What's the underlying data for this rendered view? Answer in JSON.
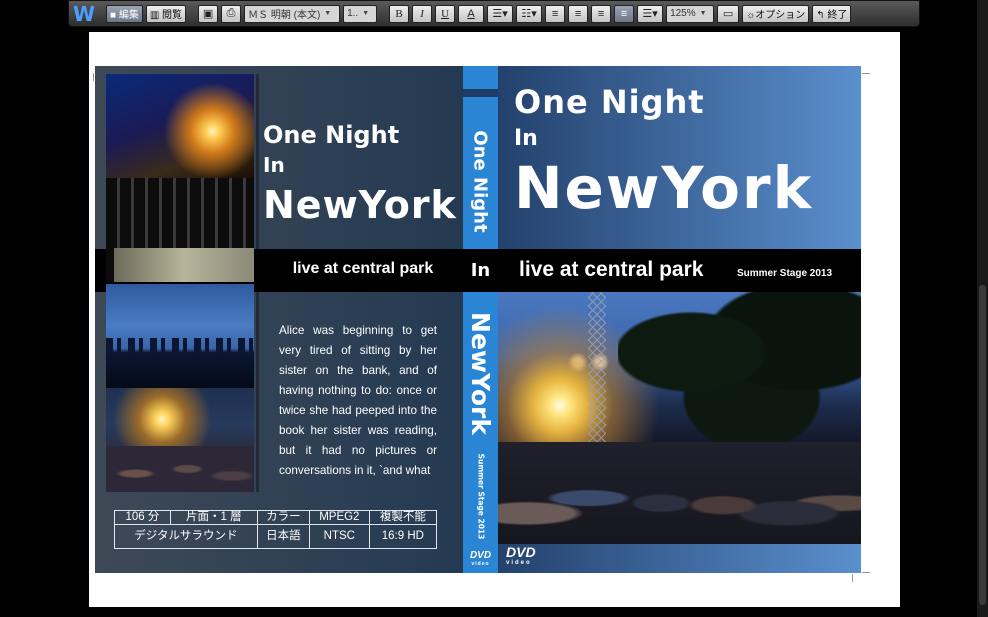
{
  "toolbar": {
    "logo": "W",
    "edit_label": "■ 編集",
    "browse_label": "▥ 閲覧",
    "font_name": "ＭＳ 明朝 (本文)",
    "font_size": "1..",
    "bold": "B",
    "italic": "I",
    "underline": "U",
    "font_color": "A",
    "zoom": "125%",
    "options_label": "☼オプション",
    "exit_label": "↰ 終了"
  },
  "cover": {
    "back": {
      "title_line1": "One Night",
      "title_line2": "In",
      "title_line3": "NewYork",
      "live": "live at central park",
      "synopsis": "Alice was beginning to get very tired of sitting by her sister on the bank, and of having nothing to do: once or twice she had peeped into the book her sister was reading, but it had no pictures or conversations in it, `and what",
      "specs": {
        "row1": [
          "106 分",
          "片面・1 層",
          "カラー",
          "MPEG2",
          "複製不能"
        ],
        "row2": [
          "デジタルサラウンド",
          "日本語",
          "NTSC",
          "16:9 HD"
        ]
      }
    },
    "spine": {
      "title": "One Night",
      "in": "In",
      "title2": "NewYork",
      "subtitle": "Summer Stage 2013",
      "dvd": "DVD",
      "dvd_sub": "video"
    },
    "front": {
      "title_line1": "One Night",
      "title_line2": "In",
      "title_line3": "NewYork",
      "live": "live at central park",
      "stage": "Summer Stage 2013",
      "dvd": "DVD",
      "dvd_sub": "video"
    }
  },
  "colors": {
    "spine": "#2a86d5",
    "back_bg": "#243a52",
    "front_gradient_end": "#5a8fce"
  }
}
